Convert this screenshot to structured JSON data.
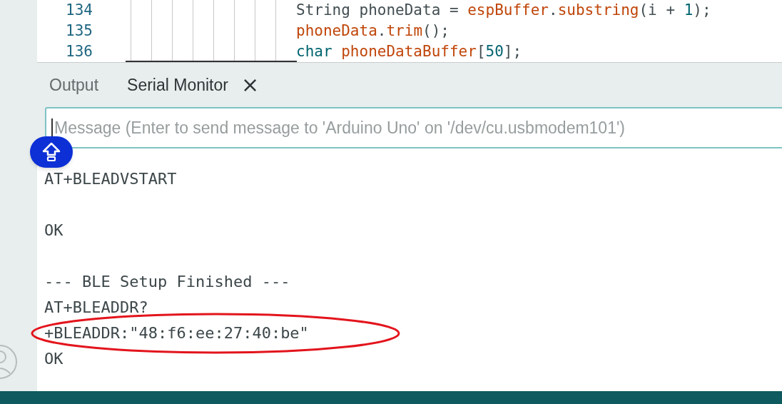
{
  "editor": {
    "lines": [
      {
        "number": "134",
        "tokens": [
          {
            "kind": "plain",
            "text": "String phoneData = "
          },
          {
            "kind": "ident",
            "text": "espBuffer"
          },
          {
            "kind": "plain",
            "text": "."
          },
          {
            "kind": "ident",
            "text": "substring"
          },
          {
            "kind": "plain",
            "text": "(i + "
          },
          {
            "kind": "number",
            "text": "1"
          },
          {
            "kind": "plain",
            "text": ");"
          }
        ]
      },
      {
        "number": "135",
        "tokens": [
          {
            "kind": "ident",
            "text": "phoneData"
          },
          {
            "kind": "plain",
            "text": "."
          },
          {
            "kind": "ident",
            "text": "trim"
          },
          {
            "kind": "plain",
            "text": "();"
          }
        ]
      },
      {
        "number": "136",
        "tokens": [
          {
            "kind": "number",
            "text": "char"
          },
          {
            "kind": "ident",
            "text": " phoneDataBuffer"
          },
          {
            "kind": "plain",
            "text": "["
          },
          {
            "kind": "number",
            "text": "50"
          },
          {
            "kind": "plain",
            "text": "];"
          }
        ]
      }
    ]
  },
  "panel": {
    "tabs": [
      {
        "label": "Output",
        "selected": false
      },
      {
        "label": "Serial Monitor",
        "selected": true,
        "close": "×"
      }
    ],
    "message_field": {
      "placeholder": "Message (Enter to send message to 'Arduino Uno' on '/dev/cu.usbmodem101')"
    },
    "output": [
      {
        "text": "AT+BLEADVSTART",
        "blank_before": false,
        "circled": false
      },
      {
        "text": "OK",
        "blank_before": true,
        "circled": false
      },
      {
        "text": "--- BLE Setup Finished ---",
        "blank_before": true,
        "circled": false
      },
      {
        "text": "AT+BLEADDR?",
        "blank_before": false,
        "circled": false
      },
      {
        "text": "+BLEADDR:\"48:f6:ee:27:40:be\"",
        "blank_before": false,
        "circled": true
      },
      {
        "text": "OK",
        "blank_before": false,
        "circled": false
      }
    ]
  }
}
